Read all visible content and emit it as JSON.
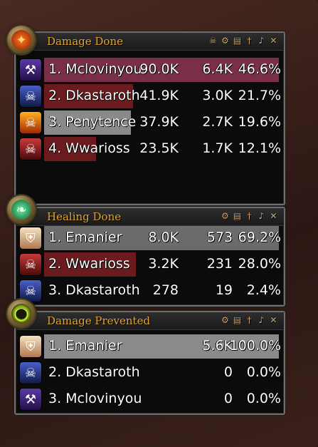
{
  "colors": {
    "title": "#e2a52f",
    "bar_purple": "#7a2f48",
    "bar_red": "#6b1b1d",
    "bar_gray": "#6b6b6b",
    "bar_gray_light": "#8a8a8a"
  },
  "panels": [
    {
      "title": "Damage Done",
      "orb_icon": "fire-icon",
      "icons": [
        "skull-icon",
        "gear-icon",
        "report-icon",
        "sword-icon",
        "speaker-icon",
        "reset-icon"
      ],
      "rows": [
        {
          "name": "1. Mclovinyou",
          "v1": "90.0K",
          "v2": "6.4K",
          "pct": "46.6%",
          "fill": 1.0,
          "bar": "bar_purple",
          "class_icon": "warrior-helm-icon"
        },
        {
          "name": "2. Dkastaroth",
          "v1": "41.9K",
          "v2": "3.0K",
          "pct": "21.7%",
          "fill": 0.38,
          "bar": "bar_red",
          "class_icon": "deathknight-skull-icon"
        },
        {
          "name": "3. Penytence",
          "v1": "37.9K",
          "v2": "2.7K",
          "pct": "19.6%",
          "fill": 0.37,
          "bar": "bar_gray_light",
          "class_icon": "fire-skull-icon"
        },
        {
          "name": "4. Wwarioss",
          "v1": "23.5K",
          "v2": "1.7K",
          "pct": "12.1%",
          "fill": 0.22,
          "bar": "bar_red",
          "class_icon": "red-skull-icon"
        }
      ]
    },
    {
      "title": "Healing Done",
      "orb_icon": "leaf-icon",
      "icons": [
        "gear-icon",
        "report-icon",
        "sword-icon",
        "speaker-icon",
        "reset-icon"
      ],
      "rows": [
        {
          "name": "1. Emanier",
          "v1": "8.0K",
          "v2": "573",
          "pct": "69.2%",
          "fill": 1.0,
          "bar": "bar_gray",
          "class_icon": "paladin-shield-icon"
        },
        {
          "name": "2. Wwarioss",
          "v1": "3.2K",
          "v2": "231",
          "pct": "28.0%",
          "fill": 0.39,
          "bar": "bar_red",
          "class_icon": "red-skull-icon"
        },
        {
          "name": "3. Dkastaroth",
          "v1": "278",
          "v2": "19",
          "pct": "2.4%",
          "fill": 0.0,
          "bar": "bar_red",
          "class_icon": "deathknight-skull-icon"
        }
      ]
    },
    {
      "title": "Damage Prevented",
      "orb_icon": "ring-icon",
      "icons": [
        "gear-icon",
        "report-icon",
        "sword-icon",
        "speaker-icon",
        "reset-icon"
      ],
      "rows": [
        {
          "name": "1. Emanier",
          "v1": "",
          "v2": "5.6K",
          "pct": "100.0%",
          "fill": 1.0,
          "bar": "bar_gray_light",
          "class_icon": "paladin-shield-icon"
        },
        {
          "name": "2. Dkastaroth",
          "v1": "",
          "v2": "0",
          "pct": "0.0%",
          "fill": 0.0,
          "bar": "bar_red",
          "class_icon": "deathknight-skull-icon"
        },
        {
          "name": "3. Mclovinyou",
          "v1": "",
          "v2": "0",
          "pct": "0.0%",
          "fill": 0.0,
          "bar": "bar_purple",
          "class_icon": "warrior-helm-icon"
        }
      ]
    }
  ]
}
